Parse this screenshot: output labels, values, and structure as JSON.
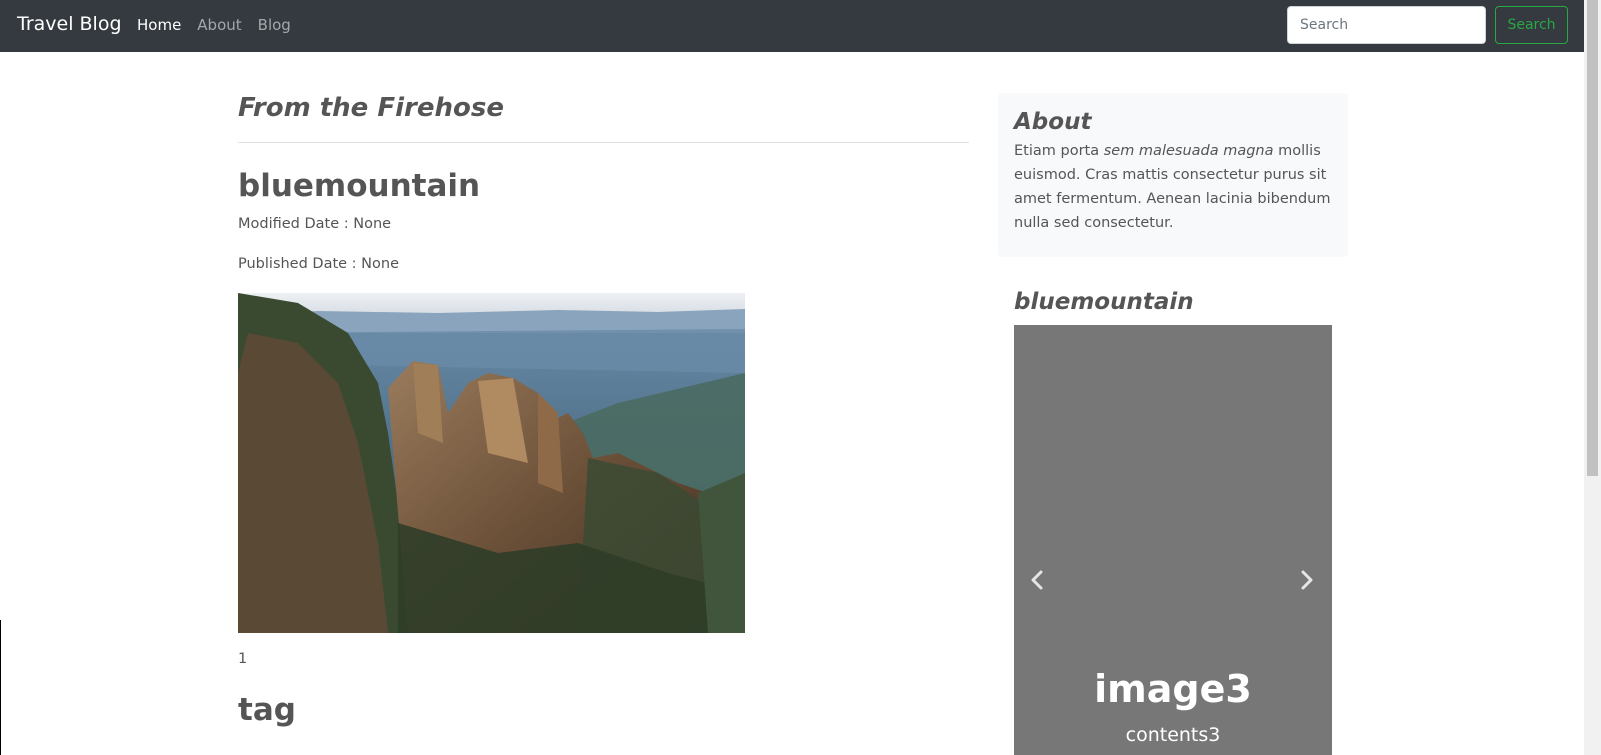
{
  "navbar": {
    "brand": "Travel Blog",
    "links": [
      {
        "label": "Home",
        "active": true
      },
      {
        "label": "About",
        "active": false
      },
      {
        "label": "Blog",
        "active": false
      }
    ],
    "search_placeholder": "Search",
    "search_button": "Search"
  },
  "main": {
    "section_heading": "From the Firehose",
    "post": {
      "title": "bluemountain",
      "modified": "Modified Date : None",
      "published": "Published Date : None",
      "image_icon": "mountain-landscape-photo",
      "count": "1"
    },
    "tag_heading": "tag"
  },
  "sidebar": {
    "about": {
      "title": "About",
      "text_before": "Etiam porta ",
      "text_em": "sem malesuada magna",
      "text_after": " mollis euismod. Cras mattis consectetur purus sit amet fermentum. Aenean lacinia bibendum nulla sed consectetur."
    },
    "carousel": {
      "title": "bluemountain",
      "caption_title": "image3",
      "caption_text": "contents3",
      "prev_icon": "chevron-left-icon",
      "next_icon": "chevron-right-icon"
    }
  },
  "colors": {
    "navbar_bg": "#343a40",
    "success": "#28a745",
    "carousel_bg": "#777777",
    "sidebar_bg": "#f8f9fa"
  }
}
